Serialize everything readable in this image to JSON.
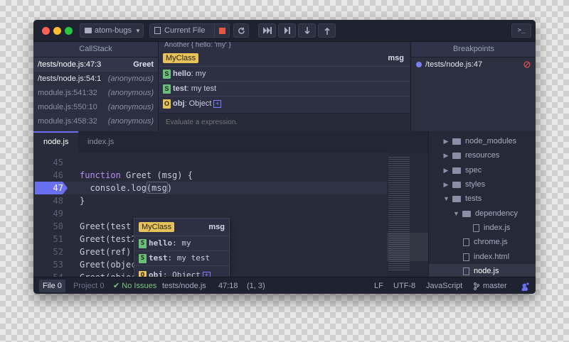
{
  "titlebar": {
    "project_label": "atom-bugs",
    "run_target_label": "Current File",
    "terminal_label": ">_"
  },
  "callstack": {
    "title": "CallStack",
    "rows": [
      {
        "location": "/tests/node.js:47:3",
        "function": "Greet"
      },
      {
        "location": "/tests/node.js:54:1",
        "function": "(anonymous)"
      },
      {
        "location": "module.js:541:32",
        "function": "(anonymous)"
      },
      {
        "location": "module.js:550:10",
        "function": "(anonymous)"
      },
      {
        "location": "module.js:458:32",
        "function": "(anonymous)"
      }
    ]
  },
  "inspector": {
    "truncated_top": "Another { hello: 'my' }",
    "class_name": "MyClass",
    "variable_name": "msg",
    "properties": [
      {
        "badge": "S",
        "key": "hello",
        "value": "my"
      },
      {
        "badge": "S",
        "key": "test",
        "value": "my test"
      },
      {
        "badge": "O",
        "key": "obj",
        "value": "Object"
      }
    ],
    "expression_placeholder": "Evaluate a expression."
  },
  "breakpoints": {
    "title": "Breakpoints",
    "items": [
      {
        "location": "/tests/node.js:47"
      }
    ]
  },
  "editor": {
    "tabs": [
      {
        "label": "node.js",
        "active": true
      },
      {
        "label": "index.js",
        "active": false
      }
    ],
    "lines": [
      {
        "num": "45",
        "text": ""
      },
      {
        "num": "46",
        "text": "function Greet (msg) {"
      },
      {
        "num": "47",
        "text": "  console.log(msg)"
      },
      {
        "num": "48",
        "text": "}"
      },
      {
        "num": "49",
        "text": ""
      },
      {
        "num": "50",
        "text": "Greet(test"
      },
      {
        "num": "51",
        "text": "Greet(test2"
      },
      {
        "num": "52",
        "text": "Greet(ref)"
      },
      {
        "num": "53",
        "text": "Greet(objec"
      },
      {
        "num": "54",
        "text": "Greet(object2)"
      }
    ],
    "current_line": "47",
    "hover_popup": {
      "class_name": "MyClass",
      "variable_name": "msg",
      "properties": [
        {
          "badge": "S",
          "key": "hello",
          "value": "my"
        },
        {
          "badge": "S",
          "key": "test",
          "value": "my test"
        },
        {
          "badge": "O",
          "key": "obj",
          "value": "Object"
        }
      ]
    }
  },
  "tree": {
    "items": [
      {
        "label": "node_modules",
        "type": "folder",
        "expanded": false,
        "depth": 0
      },
      {
        "label": "resources",
        "type": "folder",
        "expanded": false,
        "depth": 0
      },
      {
        "label": "spec",
        "type": "folder",
        "expanded": false,
        "depth": 0
      },
      {
        "label": "styles",
        "type": "folder",
        "expanded": false,
        "depth": 0
      },
      {
        "label": "tests",
        "type": "folder",
        "expanded": true,
        "depth": 0
      },
      {
        "label": "dependency",
        "type": "folder",
        "expanded": true,
        "depth": 1
      },
      {
        "label": "index.js",
        "type": "file",
        "depth": 2
      },
      {
        "label": "chrome.js",
        "type": "file",
        "depth": 1
      },
      {
        "label": "index.html",
        "type": "file",
        "depth": 1
      },
      {
        "label": "node.js",
        "type": "file",
        "depth": 1,
        "selected": true
      }
    ]
  },
  "status": {
    "file_label": "File",
    "file_count": "0",
    "project_label": "Project",
    "project_count": "0",
    "issues": "No Issues",
    "path": "tests/node.js",
    "cursor": "47:18",
    "selection": "(1, 3)",
    "line_ending": "LF",
    "encoding": "UTF-8",
    "grammar": "JavaScript",
    "branch": "master"
  },
  "colors": {
    "accent": "#6a6ff0",
    "class_badge": "#e8c35a",
    "string_badge": "#6cbf7a",
    "keyword": "#b78cf5",
    "breakpoint_dot": "#7b7ff5",
    "remove_icon": "#e05252"
  }
}
